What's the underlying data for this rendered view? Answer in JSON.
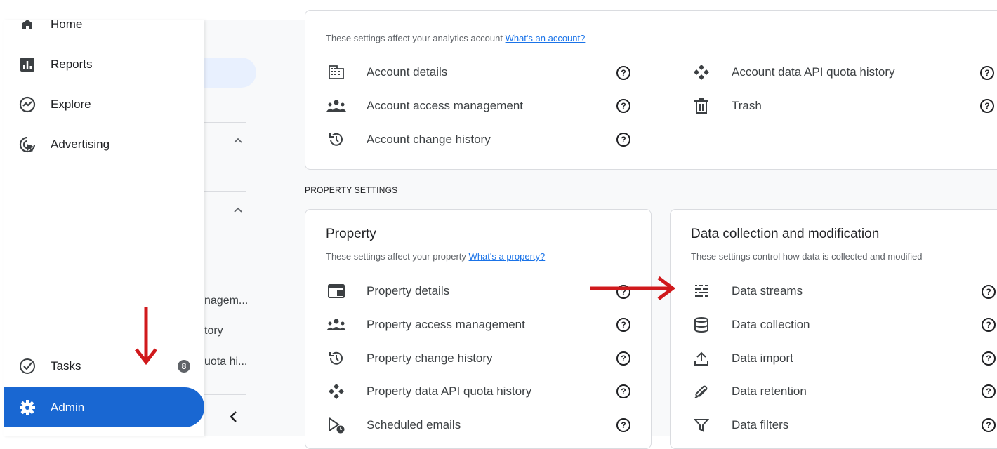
{
  "sidebar": {
    "items": [
      {
        "label": "Home",
        "icon": "home-icon"
      },
      {
        "label": "Reports",
        "icon": "bar-chart-icon"
      },
      {
        "label": "Explore",
        "icon": "explore-icon"
      },
      {
        "label": "Advertising",
        "icon": "advertising-icon"
      }
    ],
    "tasks": {
      "label": "Tasks",
      "badge": "8",
      "icon": "check-circle-icon"
    },
    "admin": {
      "label": "Admin",
      "icon": "gear-icon"
    }
  },
  "background_panel": {
    "texts": [
      "nagem...",
      "tory",
      "uota hi..."
    ]
  },
  "account_card": {
    "description": "These settings affect your analytics account",
    "link": "What's an account?",
    "rows_left": [
      {
        "label": "Account details",
        "icon": "building-icon"
      },
      {
        "label": "Account access management",
        "icon": "people-icon"
      },
      {
        "label": "Account change history",
        "icon": "history-icon"
      }
    ],
    "rows_right": [
      {
        "label": "Account data API quota history",
        "icon": "api-quota-icon"
      },
      {
        "label": "Trash",
        "icon": "trash-icon"
      }
    ]
  },
  "property_settings_label": "PROPERTY SETTINGS",
  "property_card": {
    "title": "Property",
    "description": "These settings affect your property",
    "link": "What's a property?",
    "rows": [
      {
        "label": "Property details",
        "icon": "property-details-icon"
      },
      {
        "label": "Property access management",
        "icon": "people-icon"
      },
      {
        "label": "Property change history",
        "icon": "history-icon"
      },
      {
        "label": "Property data API quota history",
        "icon": "api-quota-icon"
      },
      {
        "label": "Scheduled emails",
        "icon": "scheduled-email-icon"
      }
    ]
  },
  "data_card": {
    "title": "Data collection and modification",
    "description": "These settings control how data is collected and modified",
    "rows": [
      {
        "label": "Data streams",
        "icon": "data-streams-icon"
      },
      {
        "label": "Data collection",
        "icon": "database-icon"
      },
      {
        "label": "Data import",
        "icon": "upload-icon"
      },
      {
        "label": "Data retention",
        "icon": "retention-icon"
      },
      {
        "label": "Data filters",
        "icon": "filter-icon"
      }
    ]
  },
  "colors": {
    "accent": "#1967d2",
    "annotation_arrow": "#d0191c",
    "link": "#1a73e8"
  }
}
